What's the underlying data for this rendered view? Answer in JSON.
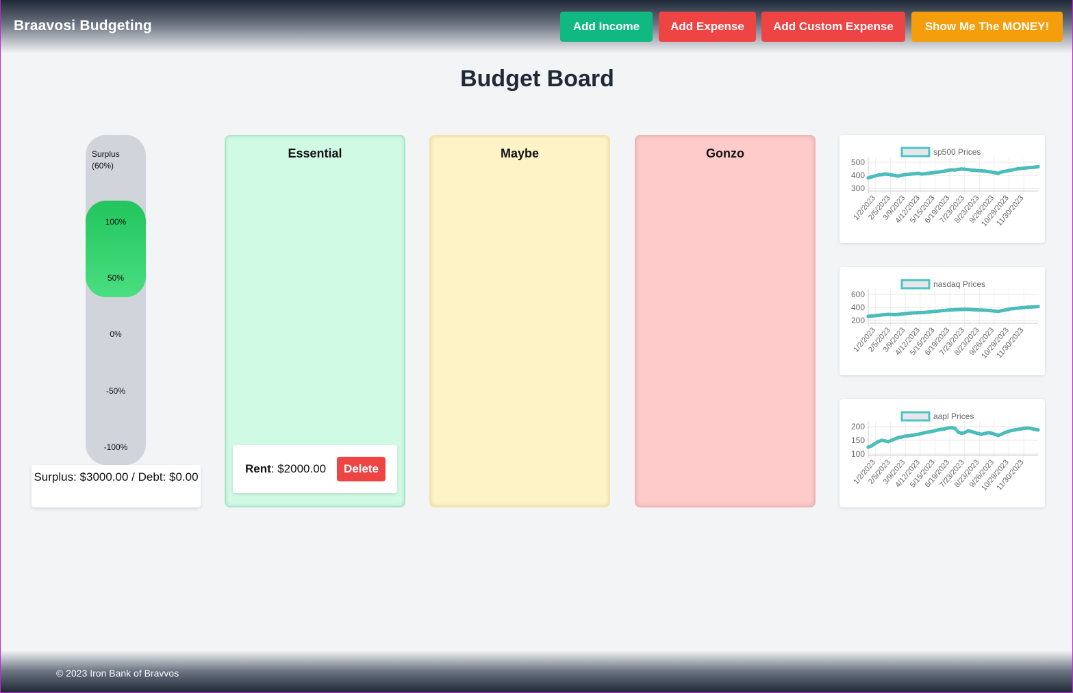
{
  "header": {
    "brand": "Braavosi Budgeting",
    "buttons": {
      "add_income": "Add Income",
      "add_expense": "Add Expense",
      "add_custom_expense": "Add Custom Expense",
      "show_money": "Show Me The MONEY!"
    }
  },
  "page_title": "Budget Board",
  "meter": {
    "label_line1": "Surplus",
    "label_line2": "(60%)",
    "surplus_percent": 60,
    "ticks": [
      "100%",
      "50%",
      "0%",
      "-50%",
      "-100%"
    ],
    "summary": "Surplus: $3000.00 / Debt: $0.00"
  },
  "columns": {
    "essential": {
      "title": "Essential",
      "expenses": [
        {
          "name": "Rent",
          "amount": ": $2000.00",
          "delete_label": "Delete"
        }
      ]
    },
    "maybe": {
      "title": "Maybe"
    },
    "gonzo": {
      "title": "Gonzo"
    }
  },
  "chart_data": [
    {
      "type": "line",
      "title": "",
      "series": [
        {
          "name": "sp500 Prices",
          "color": "#4fc3c3",
          "values": [
            380,
            388,
            395,
            402,
            405,
            410,
            408,
            402,
            398,
            394,
            400,
            405,
            408,
            410,
            412,
            415,
            410,
            412,
            415,
            418,
            422,
            425,
            428,
            432,
            438,
            442,
            440,
            445,
            448,
            446,
            443,
            440,
            438,
            436,
            434,
            432,
            428,
            425,
            420,
            415,
            425,
            430,
            435,
            440,
            445,
            450,
            452,
            455,
            458,
            460,
            462,
            465
          ]
        }
      ],
      "x_tick_labels": [
        "1/2/2023",
        "2/5/2023",
        "3/9/2023",
        "4/12/2023",
        "5/15/2023",
        "6/19/2023",
        "7/23/2023",
        "8/23/2023",
        "9/26/2023",
        "10/29/2023",
        "11/30/2023"
      ],
      "y_ticks": [
        300,
        400,
        500
      ],
      "ylim": [
        280,
        520
      ]
    },
    {
      "type": "line",
      "title": "",
      "series": [
        {
          "name": "nasdaq Prices",
          "color": "#4fc3c3",
          "values": [
            265,
            270,
            275,
            280,
            285,
            290,
            295,
            292,
            290,
            295,
            300,
            305,
            310,
            315,
            318,
            320,
            322,
            325,
            330,
            335,
            340,
            345,
            350,
            355,
            360,
            362,
            365,
            368,
            370,
            372,
            370,
            368,
            365,
            362,
            360,
            358,
            355,
            350,
            345,
            340,
            350,
            360,
            370,
            380,
            385,
            390,
            395,
            400,
            405,
            408,
            410,
            415
          ]
        }
      ],
      "x_tick_labels": [
        "1/2/2023",
        "2/5/2023",
        "3/9/2023",
        "4/12/2023",
        "5/15/2023",
        "6/19/2023",
        "7/23/2023",
        "8/23/2023",
        "9/26/2023",
        "10/29/2023",
        "11/30/2023"
      ],
      "y_ticks": [
        200,
        400,
        600
      ],
      "ylim": [
        160,
        640
      ]
    },
    {
      "type": "line",
      "title": "",
      "series": [
        {
          "name": "aapl Prices",
          "color": "#4fc3c3",
          "values": [
            125,
            130,
            138,
            145,
            150,
            148,
            145,
            150,
            155,
            160,
            162,
            165,
            166,
            168,
            170,
            172,
            175,
            178,
            180,
            182,
            185,
            188,
            190,
            192,
            195,
            196,
            194,
            180,
            176,
            178,
            185,
            182,
            178,
            175,
            172,
            175,
            178,
            176,
            172,
            168,
            172,
            178,
            182,
            186,
            188,
            190,
            192,
            194,
            195,
            193,
            190,
            188
          ]
        }
      ],
      "x_tick_labels": [
        "1/2/2023",
        "2/5/2023",
        "3/9/2023",
        "4/12/2023",
        "5/15/2023",
        "6/19/2023",
        "7/23/2023",
        "8/23/2023",
        "9/26/2023",
        "10/29/2023",
        "11/30/2023"
      ],
      "y_ticks": [
        100,
        150,
        200
      ],
      "ylim": [
        95,
        210
      ]
    }
  ],
  "footer": {
    "text": "© 2023 Iron Bank of Bravvos"
  }
}
